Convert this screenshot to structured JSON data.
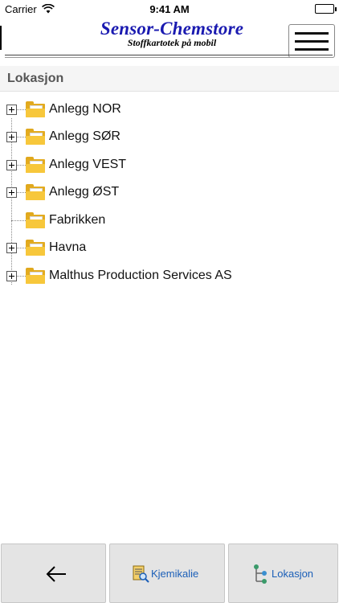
{
  "status_bar": {
    "carrier": "Carrier",
    "time": "9:41 AM"
  },
  "header": {
    "logo_title": "Sensor-Chemstore",
    "logo_subtitle": "Stoffkartotek på mobil"
  },
  "section": {
    "title": "Lokasjon"
  },
  "tree": {
    "items": [
      {
        "label": "Anlegg NOR",
        "expandable": true
      },
      {
        "label": "Anlegg SØR",
        "expandable": true
      },
      {
        "label": "Anlegg VEST",
        "expandable": true
      },
      {
        "label": "Anlegg ØST",
        "expandable": true
      },
      {
        "label": "Fabrikken",
        "expandable": false
      },
      {
        "label": "Havna",
        "expandable": true
      },
      {
        "label": "Malthus Production Services AS",
        "expandable": true
      }
    ]
  },
  "toolbar": {
    "back_icon": "arrow-left-icon",
    "kjemikalie_label": "Kjemikalie",
    "lokasjon_label": "Lokasjon"
  },
  "colors": {
    "logo_blue": "#1a1ab0",
    "folder_yellow": "#f7c73b",
    "toolbar_text_blue": "#1b5fb8",
    "toolbar_bg": "#e4e4e4"
  }
}
